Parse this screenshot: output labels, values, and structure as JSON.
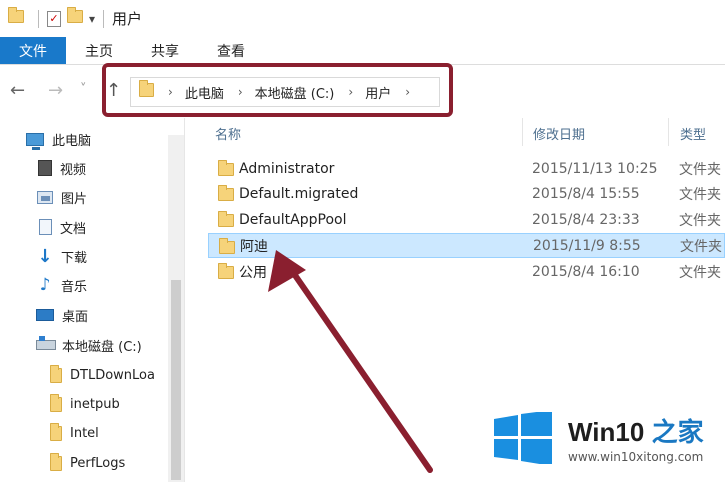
{
  "window": {
    "title": "用户",
    "qat_dropdown": "▾"
  },
  "ribbon": {
    "tabs": [
      "文件",
      "主页",
      "共享",
      "查看"
    ]
  },
  "address": {
    "back": "←",
    "forward": "→",
    "recent": "˅",
    "up": "↑",
    "crumbs": [
      "此电脑",
      "本地磁盘 (C:)",
      "用户"
    ],
    "separator": "›"
  },
  "nav": {
    "items": [
      {
        "label": "此电脑",
        "icon": "pc-icon"
      },
      {
        "label": "视频",
        "icon": "video-icon"
      },
      {
        "label": "图片",
        "icon": "picture-icon"
      },
      {
        "label": "文档",
        "icon": "document-icon"
      },
      {
        "label": "下载",
        "icon": "download-icon"
      },
      {
        "label": "音乐",
        "icon": "music-icon"
      },
      {
        "label": "桌面",
        "icon": "desktop-icon"
      },
      {
        "label": "本地磁盘 (C:)",
        "icon": "drive-icon"
      },
      {
        "label": "DTLDownLoa",
        "icon": "folder-icon"
      },
      {
        "label": "inetpub",
        "icon": "folder-icon"
      },
      {
        "label": "Intel",
        "icon": "folder-icon"
      },
      {
        "label": "PerfLogs",
        "icon": "folder-icon"
      }
    ]
  },
  "columns": {
    "name": "名称",
    "date": "修改日期",
    "type": "类型"
  },
  "files": [
    {
      "name": "Administrator",
      "date": "2015/11/13 10:25",
      "type": "文件夹"
    },
    {
      "name": "Default.migrated",
      "date": "2015/8/4 15:55",
      "type": "文件夹"
    },
    {
      "name": "DefaultAppPool",
      "date": "2015/8/4 23:33",
      "type": "文件夹"
    },
    {
      "name": "阿迪",
      "date": "2015/11/9 8:55",
      "type": "文件夹",
      "selected": true
    },
    {
      "name": "公用",
      "date": "2015/8/4 16:10",
      "type": "文件夹"
    }
  ],
  "watermark": {
    "brand": "Win10",
    "brand_zh": "之家",
    "url": "www.win10xitong.com"
  },
  "colors": {
    "file_tab": "#1979ca",
    "selection": "#cce8ff",
    "annotation": "#8a1f2f",
    "folder": "#f6d37a"
  }
}
